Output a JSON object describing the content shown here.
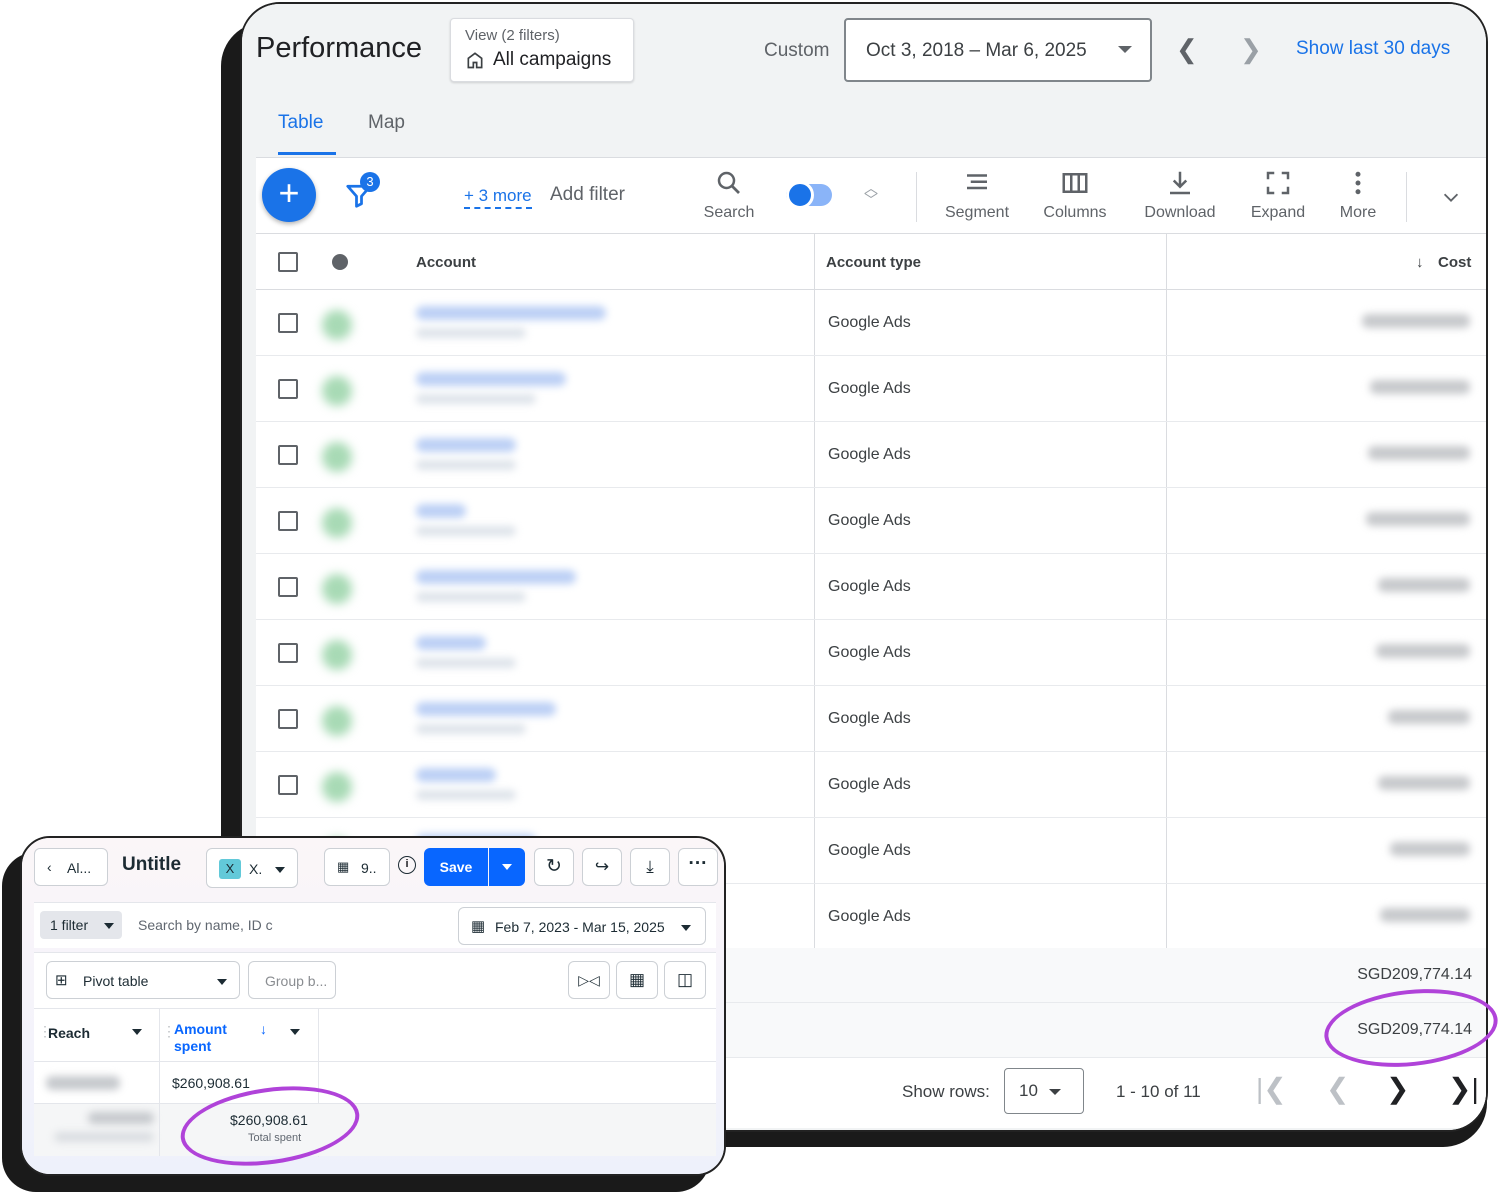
{
  "gads": {
    "title": "Performance",
    "view_sub": "View (2 filters)",
    "view_main": "All campaigns",
    "custom_label": "Custom",
    "date_range": "Oct 3, 2018 – Mar 6, 2025",
    "show_last": "Show last 30 days",
    "tabs": [
      {
        "label": "Table"
      },
      {
        "label": "Map"
      }
    ],
    "filter_count": "3",
    "more_filters": "+ 3 more",
    "add_filter": "Add filter",
    "tools": {
      "search": "Search",
      "segment": "Segment",
      "columns": "Columns",
      "download": "Download",
      "expand": "Expand",
      "more": "More"
    },
    "headers": {
      "account": "Account",
      "account_type": "Account type",
      "cost": "Cost"
    },
    "rows": [
      {
        "type": "Google Ads"
      },
      {
        "type": "Google Ads"
      },
      {
        "type": "Google Ads"
      },
      {
        "type": "Google Ads"
      },
      {
        "type": "Google Ads"
      },
      {
        "type": "Google Ads"
      },
      {
        "type": "Google Ads"
      },
      {
        "type": "Google Ads"
      },
      {
        "type": "Google Ads"
      },
      {
        "type": "Google Ads"
      }
    ],
    "totals": [
      "SGD209,774.14",
      "SGD209,774.14"
    ],
    "show_rows_label": "Show rows:",
    "rows_per_page": "10",
    "range": "1 - 10 of 11",
    "accent": "#1a73e8"
  },
  "meta": {
    "back_label": "Al...",
    "report_title": "Untitle",
    "x_label": "X.",
    "campaigns_label": "9..",
    "save_label": "Save",
    "filter_label": "1 filter",
    "search_placeholder": "Search by name, ID c",
    "date_range": "Feb 7, 2023 - Mar 15, 2025",
    "pivot_label": "Pivot table",
    "group_placeholder": "Group b...",
    "col_reach": "Reach",
    "col_amount": "Amount spent",
    "amount_row": "$260,908.61",
    "amount_total": "$260,908.61",
    "total_caption": "Total spent",
    "accent": "#0866ff"
  },
  "highlight_color": "#b043d9"
}
